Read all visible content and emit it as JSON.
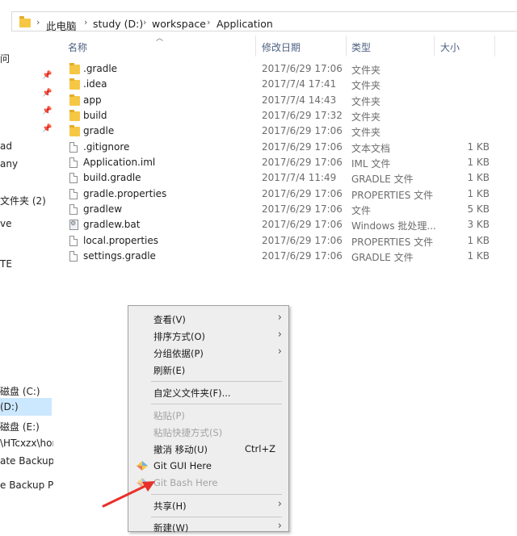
{
  "address": {
    "crumbs": [
      "此电脑",
      "study (D:)",
      "workspace",
      "Application"
    ]
  },
  "nav": {
    "items": [
      {
        "label": "问",
        "pinned": false
      },
      {
        "label": "",
        "pinned": true
      },
      {
        "label": "",
        "pinned": true
      },
      {
        "label": "",
        "pinned": true
      },
      {
        "label": "",
        "pinned": true
      },
      {
        "label": "ad",
        "pinned": false
      },
      {
        "label": "any",
        "pinned": false
      },
      {
        "label": "文件夹 (2)",
        "pinned": false
      },
      {
        "label": "ve",
        "pinned": false
      },
      {
        "label": "TE",
        "pinned": false
      },
      {
        "label": "磁盘 (C:)",
        "pinned": false
      },
      {
        "label": " (D:)",
        "pinned": false,
        "selected": true
      },
      {
        "label": "磁盘 (E:)",
        "pinned": false
      },
      {
        "label": "\\HTcxzx\\hon",
        "pinned": false
      },
      {
        "label": "ate Backup P",
        "pinned": false
      },
      {
        "label": "e Backup Plu",
        "pinned": false
      }
    ]
  },
  "columns": {
    "name": "名称",
    "date": "修改日期",
    "type": "类型",
    "size": "大小"
  },
  "files": [
    {
      "icon": "folder",
      "name": ".gradle",
      "date": "2017/6/29 17:06",
      "type": "文件夹",
      "size": ""
    },
    {
      "icon": "folder",
      "name": ".idea",
      "date": "2017/7/4 17:41",
      "type": "文件夹",
      "size": ""
    },
    {
      "icon": "folder",
      "name": "app",
      "date": "2017/7/4 14:43",
      "type": "文件夹",
      "size": ""
    },
    {
      "icon": "folder",
      "name": "build",
      "date": "2017/6/29 17:32",
      "type": "文件夹",
      "size": ""
    },
    {
      "icon": "folder",
      "name": "gradle",
      "date": "2017/6/29 17:06",
      "type": "文件夹",
      "size": ""
    },
    {
      "icon": "file",
      "name": ".gitignore",
      "date": "2017/6/29 17:06",
      "type": "文本文档",
      "size": "1 KB"
    },
    {
      "icon": "file",
      "name": "Application.iml",
      "date": "2017/6/29 17:06",
      "type": "IML 文件",
      "size": "1 KB"
    },
    {
      "icon": "file",
      "name": "build.gradle",
      "date": "2017/7/4 11:49",
      "type": "GRADLE 文件",
      "size": "1 KB"
    },
    {
      "icon": "file",
      "name": "gradle.properties",
      "date": "2017/6/29 17:06",
      "type": "PROPERTIES 文件",
      "size": "1 KB"
    },
    {
      "icon": "file",
      "name": "gradlew",
      "date": "2017/6/29 17:06",
      "type": "文件",
      "size": "5 KB"
    },
    {
      "icon": "bat",
      "name": "gradlew.bat",
      "date": "2017/6/29 17:06",
      "type": "Windows 批处理...",
      "size": "3 KB"
    },
    {
      "icon": "file",
      "name": "local.properties",
      "date": "2017/6/29 17:06",
      "type": "PROPERTIES 文件",
      "size": "1 KB"
    },
    {
      "icon": "file",
      "name": "settings.gradle",
      "date": "2017/6/29 17:06",
      "type": "GRADLE 文件",
      "size": "1 KB"
    }
  ],
  "context_menu": {
    "items": [
      {
        "label": "查看(V)",
        "submenu": true
      },
      {
        "label": "排序方式(O)",
        "submenu": true
      },
      {
        "label": "分组依据(P)",
        "submenu": true
      },
      {
        "label": "刷新(E)"
      },
      {
        "label": "自定义文件夹(F)..."
      },
      {
        "label": "粘贴(P)",
        "disabled": true
      },
      {
        "label": "粘贴快捷方式(S)",
        "disabled": true
      },
      {
        "label": "撤消 移动(U)",
        "shortcut": "Ctrl+Z"
      },
      {
        "label": "Git GUI Here",
        "icon": "git-gui-icon"
      },
      {
        "label": "Git Bash Here",
        "icon": "git-bash-icon"
      },
      {
        "label": "共享(H)",
        "submenu": true
      },
      {
        "label": "新建(W)",
        "submenu": true
      }
    ]
  },
  "colors": {
    "folder": "#f6c744",
    "selection": "#cce8ff",
    "arrow": "#e8302a",
    "menu_bg": "#eeeeee"
  }
}
